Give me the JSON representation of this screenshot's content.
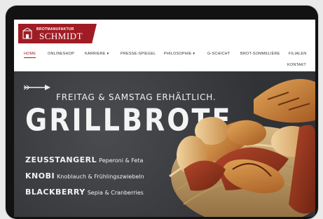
{
  "logo": {
    "small": "BROTMANUFAKTUR",
    "big": "SCHMIDT"
  },
  "nav": {
    "items": [
      {
        "label": "HOME",
        "active": true
      },
      {
        "label": "ONLINESHOP"
      },
      {
        "label": "KARRIERE ▾"
      },
      {
        "label": "PRESSE-SPIEGEL"
      },
      {
        "label": "PHILOSOPHIE ▾"
      },
      {
        "label": "G-SCHICHT"
      },
      {
        "label": "BROT-SOMMELIÈRE"
      },
      {
        "label": "FILIALEN"
      },
      {
        "label": "KONTAKT"
      }
    ]
  },
  "hero": {
    "subtitle": "FREITAG & SAMSTAG ERHÄLTLICH.",
    "title": "GRILLBROTE",
    "products": [
      {
        "name": "ZEUSSTANGERL",
        "desc": "Peperoni & Feta"
      },
      {
        "name": "KNOBI",
        "desc": "Knoblauch & Frühlingszwiebeln"
      },
      {
        "name": "BLACKBERRY",
        "desc": "Sepia & Cranberries"
      }
    ]
  },
  "colors": {
    "brand": "#a01c24",
    "hero_bg": "#3a3c3f",
    "frame": "#121212"
  }
}
